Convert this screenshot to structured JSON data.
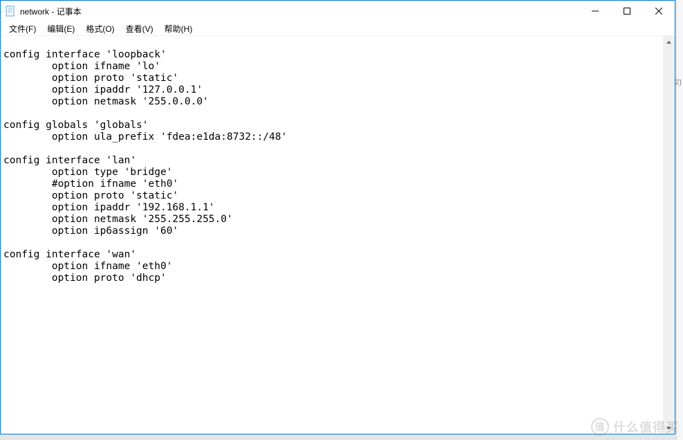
{
  "window": {
    "title": "network - 记事本"
  },
  "menubar": {
    "items": [
      {
        "label": "文件(F)"
      },
      {
        "label": "编辑(E)"
      },
      {
        "label": "格式(O)"
      },
      {
        "label": "查看(V)"
      },
      {
        "label": "帮助(H)"
      }
    ]
  },
  "editor": {
    "content": "\nconfig interface 'loopback'\n        option ifname 'lo'\n        option proto 'static'\n        option ipaddr '127.0.0.1'\n        option netmask '255.0.0.0'\n\nconfig globals 'globals'\n        option ula_prefix 'fdea:e1da:8732::/48'\n\nconfig interface 'lan'\n        option type 'bridge'\n        #option ifname 'eth0'\n        option proto 'static'\n        option ipaddr '192.168.1.1'\n        option netmask '255.255.255.0'\n        option ip6assign '60'\n\nconfig interface 'wan'\n        option ifname 'eth0'\n        option proto 'dhcp'\n"
  },
  "watermark": {
    "icon": "值",
    "text": "什么值得买"
  },
  "right_edge": {
    "label": "2)"
  }
}
